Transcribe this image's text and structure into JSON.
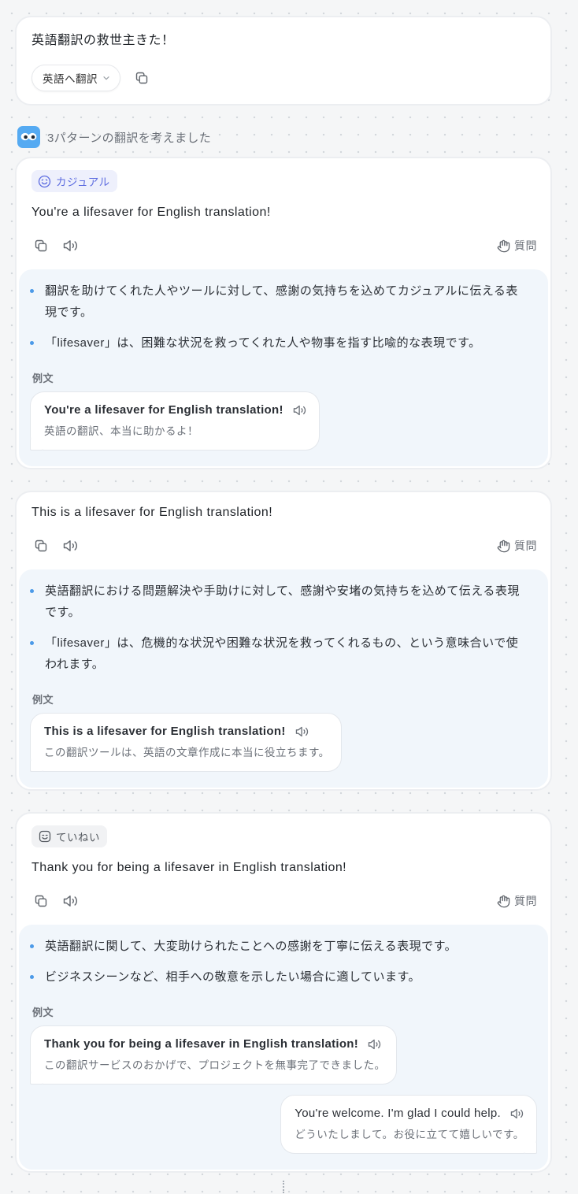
{
  "user_message": {
    "text": "英語翻訳の救世主きた！",
    "mode_dropdown_label": "英語へ翻訳",
    "mode_dropdown_icon": "chevron-down-icon",
    "copy_icon": "copy-icon"
  },
  "assistant_header": {
    "avatar_icon": "assistant-avatar-icon",
    "text": "3パターンの翻訳を考えました"
  },
  "labels": {
    "ask": "質問",
    "example": "例文"
  },
  "action_icons": {
    "copy": "copy-icon",
    "speak": "speaker-icon",
    "ask": "hand-icon"
  },
  "translations": [
    {
      "badge": {
        "label": "カジュアル",
        "icon": "smiley-icon"
      },
      "text": "You're a lifesaver for English translation!",
      "notes": [
        "翻訳を助けてくれた人やツールに対して、感謝の気持ちを込めてカジュアルに伝える表現です。",
        "「lifesaver」は、困難な状況を救ってくれた人や物事を指す比喩的な表現です。"
      ],
      "examples": [
        {
          "text": "You're a lifesaver for English translation!",
          "translation": "英語の翻訳、本当に助かるよ！"
        }
      ]
    },
    {
      "badge": null,
      "text": "This is a lifesaver for English translation!",
      "notes": [
        "英語翻訳における問題解決や手助けに対して、感謝や安堵の気持ちを込めて伝える表現です。",
        "「lifesaver」は、危機的な状況や困難な状況を救ってくれるもの、という意味合いで使われます。"
      ],
      "examples": [
        {
          "text": "This is a lifesaver for English translation!",
          "translation": "この翻訳ツールは、英語の文章作成に本当に役立ちます。"
        }
      ]
    },
    {
      "badge": {
        "label": "ていねい",
        "icon": "polite-face-icon"
      },
      "text": "Thank you for being a lifesaver in English translation!",
      "notes": [
        "英語翻訳に関して、大変助けられたことへの感謝を丁寧に伝える表現です。",
        "ビジネスシーンなど、相手への敬意を示したい場合に適しています。"
      ],
      "examples": [
        {
          "text": "Thank you for being a lifesaver in English translation!",
          "translation": "この翻訳サービスのおかげで、プロジェクトを無事完了できました。"
        },
        {
          "text": "You're welcome. I'm glad I could help.",
          "translation": "どういたしまして。お役に立てて嬉しいです。",
          "is_reply": true
        }
      ]
    }
  ],
  "colors": {
    "accent_blue": "#4c9ae8",
    "avatar_blue": "#55aaf2",
    "explanation_bg": "#f1f6fb",
    "casual_badge_bg": "#eef0fc",
    "casual_badge_text": "#5d6ce0",
    "polite_badge_bg": "#f1f2f4",
    "polite_badge_text": "#555a60"
  }
}
